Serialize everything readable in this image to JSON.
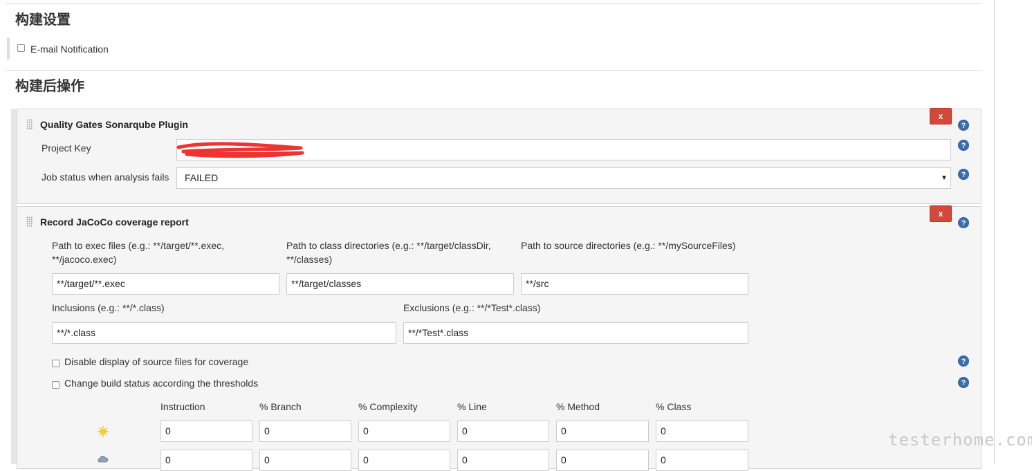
{
  "build_settings": {
    "title": "构建设置",
    "email_notification_label": "E-mail Notification"
  },
  "post_build": {
    "title": "构建后操作"
  },
  "quality_gates": {
    "title": "Quality Gates Sonarqube Plugin",
    "remove_label": "x",
    "project_key_label": "Project Key",
    "project_key_value": "",
    "job_status_label": "Job status when analysis fails",
    "job_status_value": "FAILED"
  },
  "jacoco": {
    "title": "Record JaCoCo coverage report",
    "remove_label": "x",
    "exec_label": "Path to exec files (e.g.: **/target/**.exec, **/jacoco.exec)",
    "exec_value": "**/target/**.exec",
    "class_dirs_label": "Path to class directories (e.g.: **/target/classDir, **/classes)",
    "class_dirs_value": "**/target/classes",
    "source_dirs_label": "Path to source directories (e.g.: **/mySourceFiles)",
    "source_dirs_value": "**/src",
    "inclusions_label": "Inclusions (e.g.: **/*.class)",
    "inclusions_value": "**/*.class",
    "exclusions_label": "Exclusions (e.g.: **/*Test*.class)",
    "exclusions_value": "**/*Test*.class",
    "disable_source_label": "Disable display of source files for coverage",
    "change_status_label": "Change build status according the thresholds",
    "threshold_headers": [
      "Instruction",
      "% Branch",
      "% Complexity",
      "% Line",
      "% Method",
      "% Class"
    ],
    "threshold_rows": [
      {
        "icon": "sunny-icon",
        "values": [
          "0",
          "0",
          "0",
          "0",
          "0",
          "0"
        ]
      },
      {
        "icon": "cloudy-icon",
        "values": [
          "0",
          "0",
          "0",
          "0",
          "0",
          "0"
        ]
      }
    ]
  },
  "help_icon_glyph": "?",
  "watermark": "testerhome.com",
  "colors": {
    "remove_button": "#d24939",
    "help_icon": "#3b6eb0",
    "panel_bg": "#f5f5f5",
    "redaction": "#ee2222"
  }
}
